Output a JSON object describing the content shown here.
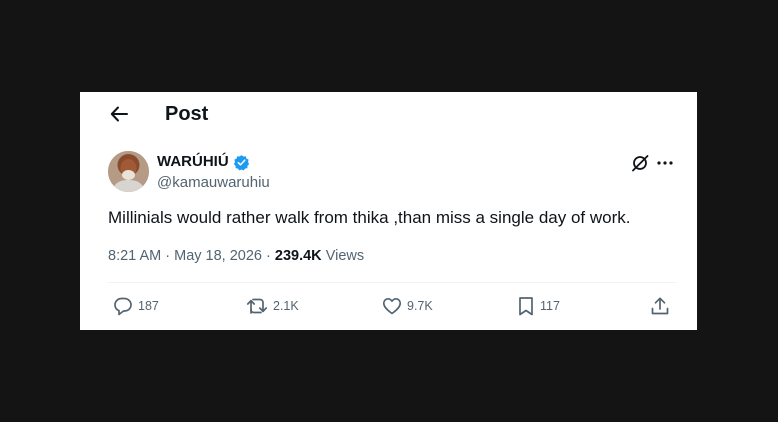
{
  "header": {
    "title": "Post",
    "back_icon": "arrow-left-icon"
  },
  "author": {
    "display_name": "WARÚHIÚ",
    "handle": "@kamauwaruhiu",
    "verified_icon": "verified-badge-icon",
    "verified_color": "#1d9bf0"
  },
  "post": {
    "text": "Millinials would rather walk from thika ,than miss a single day of work.",
    "time": "8:21 AM",
    "separator": "·",
    "date": "May 18, 2026",
    "views_count": "239.4K",
    "views_label": "Views"
  },
  "actions": {
    "replies": {
      "count": "187",
      "icon": "reply-icon"
    },
    "reposts": {
      "count": "2.1K",
      "icon": "repost-icon"
    },
    "likes": {
      "count": "9.7K",
      "icon": "heart-icon"
    },
    "bookmarks": {
      "count": "117",
      "icon": "bookmark-icon"
    },
    "share": {
      "icon": "share-icon"
    }
  },
  "colors": {
    "text_primary": "#0f1419",
    "text_secondary": "#536471",
    "background": "#ffffff",
    "frame": "#141414"
  }
}
